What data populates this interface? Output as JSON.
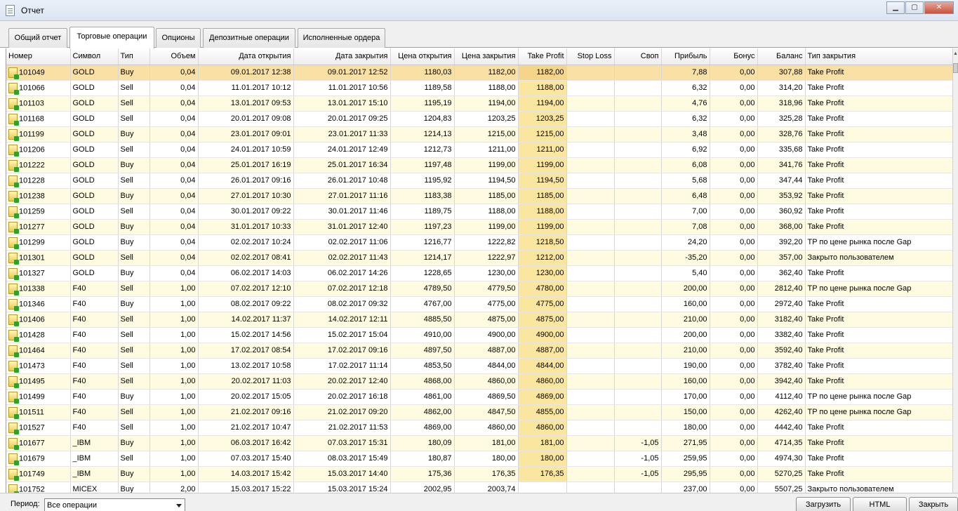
{
  "window": {
    "title": "Отчет",
    "icon": "document-icon",
    "minimize": "▁",
    "maximize": "▢",
    "close": "✕"
  },
  "tabs": [
    {
      "label": "Общий отчет"
    },
    {
      "label": "Торговые операции"
    },
    {
      "label": "Опционы"
    },
    {
      "label": "Депозитные операции"
    },
    {
      "label": "Исполненные ордера"
    }
  ],
  "active_tab": 1,
  "table": {
    "columns": [
      "Номер",
      "Символ",
      "Тип",
      "Объем",
      "Дата открытия",
      "Дата закрытия",
      "Цена открытия",
      "Цена закрытия",
      "Take Profit",
      "Stop Loss",
      "Своп",
      "Прибыль",
      "Бонус",
      "Баланс",
      "Тип закрытия"
    ],
    "rows": [
      [
        "101049",
        "GOLD",
        "Buy",
        "0,04",
        "09.01.2017 12:38",
        "09.01.2017 12:52",
        "1180,03",
        "1182,00",
        "1182,00",
        "",
        "",
        "7,88",
        "0,00",
        "307,88",
        "Take Profit"
      ],
      [
        "101066",
        "GOLD",
        "Sell",
        "0,04",
        "11.01.2017 10:12",
        "11.01.2017 10:56",
        "1189,58",
        "1188,00",
        "1188,00",
        "",
        "",
        "6,32",
        "0,00",
        "314,20",
        "Take Profit"
      ],
      [
        "101103",
        "GOLD",
        "Sell",
        "0,04",
        "13.01.2017 09:53",
        "13.01.2017 15:10",
        "1195,19",
        "1194,00",
        "1194,00",
        "",
        "",
        "4,76",
        "0,00",
        "318,96",
        "Take Profit"
      ],
      [
        "101168",
        "GOLD",
        "Sell",
        "0,04",
        "20.01.2017 09:08",
        "20.01.2017 09:25",
        "1204,83",
        "1203,25",
        "1203,25",
        "",
        "",
        "6,32",
        "0,00",
        "325,28",
        "Take Profit"
      ],
      [
        "101199",
        "GOLD",
        "Buy",
        "0,04",
        "23.01.2017 09:01",
        "23.01.2017 11:33",
        "1214,13",
        "1215,00",
        "1215,00",
        "",
        "",
        "3,48",
        "0,00",
        "328,76",
        "Take Profit"
      ],
      [
        "101206",
        "GOLD",
        "Sell",
        "0,04",
        "24.01.2017 10:59",
        "24.01.2017 12:49",
        "1212,73",
        "1211,00",
        "1211,00",
        "",
        "",
        "6,92",
        "0,00",
        "335,68",
        "Take Profit"
      ],
      [
        "101222",
        "GOLD",
        "Buy",
        "0,04",
        "25.01.2017 16:19",
        "25.01.2017 16:34",
        "1197,48",
        "1199,00",
        "1199,00",
        "",
        "",
        "6,08",
        "0,00",
        "341,76",
        "Take Profit"
      ],
      [
        "101228",
        "GOLD",
        "Sell",
        "0,04",
        "26.01.2017 09:16",
        "26.01.2017 10:48",
        "1195,92",
        "1194,50",
        "1194,50",
        "",
        "",
        "5,68",
        "0,00",
        "347,44",
        "Take Profit"
      ],
      [
        "101238",
        "GOLD",
        "Buy",
        "0,04",
        "27.01.2017 10:30",
        "27.01.2017 11:16",
        "1183,38",
        "1185,00",
        "1185,00",
        "",
        "",
        "6,48",
        "0,00",
        "353,92",
        "Take Profit"
      ],
      [
        "101259",
        "GOLD",
        "Sell",
        "0,04",
        "30.01.2017 09:22",
        "30.01.2017 11:46",
        "1189,75",
        "1188,00",
        "1188,00",
        "",
        "",
        "7,00",
        "0,00",
        "360,92",
        "Take Profit"
      ],
      [
        "101277",
        "GOLD",
        "Buy",
        "0,04",
        "31.01.2017 10:33",
        "31.01.2017 12:40",
        "1197,23",
        "1199,00",
        "1199,00",
        "",
        "",
        "7,08",
        "0,00",
        "368,00",
        "Take Profit"
      ],
      [
        "101299",
        "GOLD",
        "Buy",
        "0,04",
        "02.02.2017 10:24",
        "02.02.2017 11:06",
        "1216,77",
        "1222,82",
        "1218,50",
        "",
        "",
        "24,20",
        "0,00",
        "392,20",
        "TP по цене рынка после Gap"
      ],
      [
        "101301",
        "GOLD",
        "Sell",
        "0,04",
        "02.02.2017 08:41",
        "02.02.2017 11:43",
        "1214,17",
        "1222,97",
        "1212,00",
        "",
        "",
        "-35,20",
        "0,00",
        "357,00",
        "Закрыто пользователем"
      ],
      [
        "101327",
        "GOLD",
        "Buy",
        "0,04",
        "06.02.2017 14:03",
        "06.02.2017 14:26",
        "1228,65",
        "1230,00",
        "1230,00",
        "",
        "",
        "5,40",
        "0,00",
        "362,40",
        "Take Profit"
      ],
      [
        "101338",
        "F40",
        "Sell",
        "1,00",
        "07.02.2017 12:10",
        "07.02.2017 12:18",
        "4789,50",
        "4779,50",
        "4780,00",
        "",
        "",
        "200,00",
        "0,00",
        "2812,40",
        "TP по цене рынка после Gap"
      ],
      [
        "101346",
        "F40",
        "Buy",
        "1,00",
        "08.02.2017 09:22",
        "08.02.2017 09:32",
        "4767,00",
        "4775,00",
        "4775,00",
        "",
        "",
        "160,00",
        "0,00",
        "2972,40",
        "Take Profit"
      ],
      [
        "101406",
        "F40",
        "Sell",
        "1,00",
        "14.02.2017 11:37",
        "14.02.2017 12:11",
        "4885,50",
        "4875,00",
        "4875,00",
        "",
        "",
        "210,00",
        "0,00",
        "3182,40",
        "Take Profit"
      ],
      [
        "101428",
        "F40",
        "Sell",
        "1,00",
        "15.02.2017 14:56",
        "15.02.2017 15:04",
        "4910,00",
        "4900,00",
        "4900,00",
        "",
        "",
        "200,00",
        "0,00",
        "3382,40",
        "Take Profit"
      ],
      [
        "101464",
        "F40",
        "Sell",
        "1,00",
        "17.02.2017 08:54",
        "17.02.2017 09:16",
        "4897,50",
        "4887,00",
        "4887,00",
        "",
        "",
        "210,00",
        "0,00",
        "3592,40",
        "Take Profit"
      ],
      [
        "101473",
        "F40",
        "Sell",
        "1,00",
        "13.02.2017 10:58",
        "17.02.2017 11:14",
        "4853,50",
        "4844,00",
        "4844,00",
        "",
        "",
        "190,00",
        "0,00",
        "3782,40",
        "Take Profit"
      ],
      [
        "101495",
        "F40",
        "Sell",
        "1,00",
        "20.02.2017 11:03",
        "20.02.2017 12:40",
        "4868,00",
        "4860,00",
        "4860,00",
        "",
        "",
        "160,00",
        "0,00",
        "3942,40",
        "Take Profit"
      ],
      [
        "101499",
        "F40",
        "Buy",
        "1,00",
        "20.02.2017 15:05",
        "20.02.2017 16:18",
        "4861,00",
        "4869,50",
        "4869,00",
        "",
        "",
        "170,00",
        "0,00",
        "4112,40",
        "TP по цене рынка после Gap"
      ],
      [
        "101511",
        "F40",
        "Sell",
        "1,00",
        "21.02.2017 09:16",
        "21.02.2017 09:20",
        "4862,00",
        "4847,50",
        "4855,00",
        "",
        "",
        "150,00",
        "0,00",
        "4262,40",
        "TP по цене рынка после Gap"
      ],
      [
        "101527",
        "F40",
        "Sell",
        "1,00",
        "21.02.2017 10:47",
        "21.02.2017 11:53",
        "4869,00",
        "4860,00",
        "4860,00",
        "",
        "",
        "180,00",
        "0,00",
        "4442,40",
        "Take Profit"
      ],
      [
        "101677",
        "_IBM",
        "Buy",
        "1,00",
        "06.03.2017 16:42",
        "07.03.2017 15:31",
        "180,09",
        "181,00",
        "181,00",
        "",
        "-1,05",
        "271,95",
        "0,00",
        "4714,35",
        "Take Profit"
      ],
      [
        "101679",
        "_IBM",
        "Sell",
        "1,00",
        "07.03.2017 15:40",
        "08.03.2017 15:49",
        "180,87",
        "180,00",
        "180,00",
        "",
        "-1,05",
        "259,95",
        "0,00",
        "4974,30",
        "Take Profit"
      ],
      [
        "101749",
        "_IBM",
        "Buy",
        "1,00",
        "14.03.2017 15:42",
        "15.03.2017 14:40",
        "175,36",
        "176,35",
        "176,35",
        "",
        "-1,05",
        "295,95",
        "0,00",
        "5270,25",
        "Take Profit"
      ],
      [
        "101752",
        "MICEX",
        "Buy",
        "2,00",
        "15.03.2017 15:22",
        "15.03.2017 15:24",
        "2002,95",
        "2003,74",
        "",
        "",
        "",
        "237,00",
        "0,00",
        "5507,25",
        "Закрыто пользователем"
      ]
    ]
  },
  "footer": {
    "period_label": "Период:",
    "period_value": "Все операции",
    "load_button": "Загрузить",
    "html_button": "HTML",
    "close_button": "Закрыть"
  }
}
